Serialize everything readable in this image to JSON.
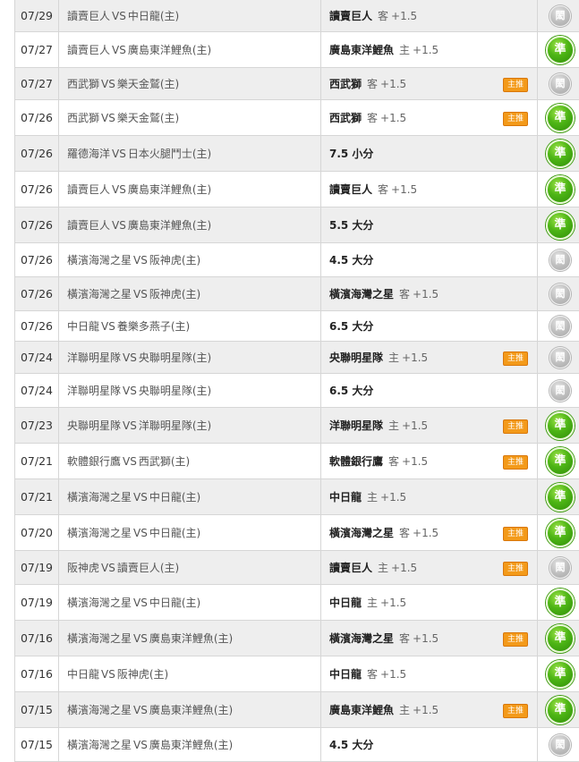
{
  "vs_label": "VS",
  "badge_label": "主推",
  "icons": {
    "win": "準",
    "push": "閎"
  },
  "rows": [
    {
      "date": "07/29",
      "home": "讀賣巨人",
      "away": "中日龍(主)",
      "pick_team": "讀賣巨人",
      "pick_type": "客",
      "pick_line": "+1.5",
      "badge": false,
      "result": "push"
    },
    {
      "date": "07/27",
      "home": "讀賣巨人",
      "away": "廣島東洋鯉魚(主)",
      "pick_team": "廣島東洋鯉魚",
      "pick_type": "主",
      "pick_line": "+1.5",
      "badge": false,
      "result": "win"
    },
    {
      "date": "07/27",
      "home": "西武獅",
      "away": "樂天金鷲(主)",
      "pick_team": "西武獅",
      "pick_type": "客",
      "pick_line": "+1.5",
      "badge": true,
      "result": "push"
    },
    {
      "date": "07/26",
      "home": "西武獅",
      "away": "樂天金鷲(主)",
      "pick_team": "西武獅",
      "pick_type": "客",
      "pick_line": "+1.5",
      "badge": true,
      "result": "win"
    },
    {
      "date": "07/26",
      "home": "羅德海洋",
      "away": "日本火腿鬥士(主)",
      "pick_team": "7.5 小分",
      "pick_type": "",
      "pick_line": "",
      "badge": false,
      "result": "win"
    },
    {
      "date": "07/26",
      "home": "讀賣巨人",
      "away": "廣島東洋鯉魚(主)",
      "pick_team": "讀賣巨人",
      "pick_type": "客",
      "pick_line": "+1.5",
      "badge": false,
      "result": "win"
    },
    {
      "date": "07/26",
      "home": "讀賣巨人",
      "away": "廣島東洋鯉魚(主)",
      "pick_team": "5.5 大分",
      "pick_type": "",
      "pick_line": "",
      "badge": false,
      "result": "win"
    },
    {
      "date": "07/26",
      "home": "橫濱海灣之星",
      "away": "阪神虎(主)",
      "pick_team": "4.5 大分",
      "pick_type": "",
      "pick_line": "",
      "badge": false,
      "result": "push"
    },
    {
      "date": "07/26",
      "home": "橫濱海灣之星",
      "away": "阪神虎(主)",
      "pick_team": "橫濱海灣之星",
      "pick_type": "客",
      "pick_line": "+1.5",
      "badge": false,
      "result": "push"
    },
    {
      "date": "07/26",
      "home": "中日龍",
      "away": "養樂多燕子(主)",
      "pick_team": "6.5 大分",
      "pick_type": "",
      "pick_line": "",
      "badge": false,
      "result": "push"
    },
    {
      "date": "07/24",
      "home": "洋聯明星隊",
      "away": "央聯明星隊(主)",
      "pick_team": "央聯明星隊",
      "pick_type": "主",
      "pick_line": "+1.5",
      "badge": true,
      "result": "push"
    },
    {
      "date": "07/24",
      "home": "洋聯明星隊",
      "away": "央聯明星隊(主)",
      "pick_team": "6.5 大分",
      "pick_type": "",
      "pick_line": "",
      "badge": false,
      "result": "push"
    },
    {
      "date": "07/23",
      "home": "央聯明星隊",
      "away": "洋聯明星隊(主)",
      "pick_team": "洋聯明星隊",
      "pick_type": "主",
      "pick_line": "+1.5",
      "badge": true,
      "result": "win"
    },
    {
      "date": "07/21",
      "home": "軟體銀行鷹",
      "away": "西武獅(主)",
      "pick_team": "軟體銀行鷹",
      "pick_type": "客",
      "pick_line": "+1.5",
      "badge": true,
      "result": "win"
    },
    {
      "date": "07/21",
      "home": "橫濱海灣之星",
      "away": "中日龍(主)",
      "pick_team": "中日龍",
      "pick_type": "主",
      "pick_line": "+1.5",
      "badge": false,
      "result": "win"
    },
    {
      "date": "07/20",
      "home": "橫濱海灣之星",
      "away": "中日龍(主)",
      "pick_team": "橫濱海灣之星",
      "pick_type": "客",
      "pick_line": "+1.5",
      "badge": true,
      "result": "win"
    },
    {
      "date": "07/19",
      "home": "阪神虎",
      "away": "讀賣巨人(主)",
      "pick_team": "讀賣巨人",
      "pick_type": "主",
      "pick_line": "+1.5",
      "badge": true,
      "result": "push"
    },
    {
      "date": "07/19",
      "home": "橫濱海灣之星",
      "away": "中日龍(主)",
      "pick_team": "中日龍",
      "pick_type": "主",
      "pick_line": "+1.5",
      "badge": false,
      "result": "win"
    },
    {
      "date": "07/16",
      "home": "橫濱海灣之星",
      "away": "廣島東洋鯉魚(主)",
      "pick_team": "橫濱海灣之星",
      "pick_type": "客",
      "pick_line": "+1.5",
      "badge": true,
      "result": "win"
    },
    {
      "date": "07/16",
      "home": "中日龍",
      "away": "阪神虎(主)",
      "pick_team": "中日龍",
      "pick_type": "客",
      "pick_line": "+1.5",
      "badge": false,
      "result": "win"
    },
    {
      "date": "07/15",
      "home": "橫濱海灣之星",
      "away": "廣島東洋鯉魚(主)",
      "pick_team": "廣島東洋鯉魚",
      "pick_type": "主",
      "pick_line": "+1.5",
      "badge": true,
      "result": "win"
    },
    {
      "date": "07/15",
      "home": "橫濱海灣之星",
      "away": "廣島東洋鯉魚(主)",
      "pick_team": "4.5 大分",
      "pick_type": "",
      "pick_line": "",
      "badge": false,
      "result": "push"
    }
  ]
}
